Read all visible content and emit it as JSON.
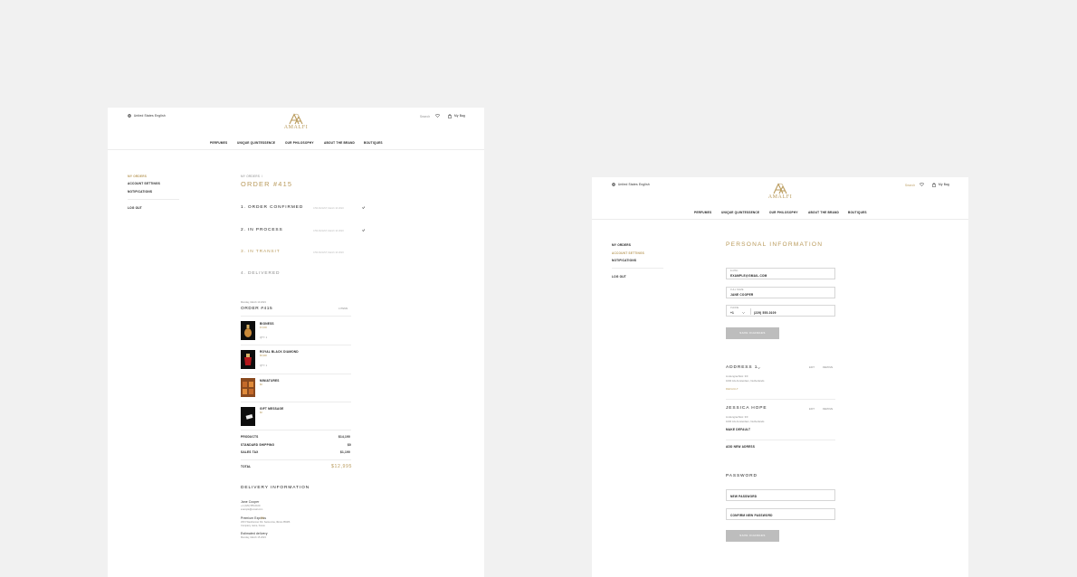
{
  "header": {
    "country": "United States",
    "language": "English",
    "search_label": "Search",
    "bag_label": "My Bag",
    "brand": "AMALFI",
    "nav": [
      "PERFUMES",
      "UNIQUE QUINTESSENCE",
      "OUR PHILOSOPHY",
      "ABOUT THE BRAND",
      "BOUTIQUES"
    ]
  },
  "sidebar": {
    "items": [
      "MY ORDERS",
      "ACCOUNT SETTINGS",
      "NOTIFICATIONS"
    ],
    "logout": "LOG OUT"
  },
  "order_page": {
    "breadcrumb": "MY ORDERS",
    "breadcrumb_sep": "/",
    "title": "ORDER #415",
    "steps": [
      {
        "label": "1.  ORDER CONFIRMED",
        "time": "4:56 AM EST, March 10 2023",
        "done": true
      },
      {
        "label": "2.  IN PROCESS",
        "time": "4:56 AM EST, March 10 2023",
        "done": true
      },
      {
        "label": "3.  IN TRANSIT",
        "time": "4:56 AM EST, March 10 2023",
        "done": false
      },
      {
        "label": "4.  DELIVERED",
        "time": "",
        "done": false
      }
    ],
    "order_date": "Monday, March 10 2023",
    "order_title": "ORDER #415",
    "items_count": "4 ITEMS",
    "items": [
      {
        "name": "BIONESS",
        "price": "$7,000",
        "qty": "QTY: 1"
      },
      {
        "name": "ROYAL BLACK DIAMOND",
        "price": "$5,990",
        "qty": "QTY: 1"
      },
      {
        "name": "MINIATURES",
        "price": "$0",
        "qty": ""
      },
      {
        "name": "GIFT MESSAGE",
        "price": "$0",
        "qty": ""
      }
    ],
    "summary": [
      {
        "label": "PRODUCTS",
        "value": "$14,190"
      },
      {
        "label": "STANDARD SHIPPING",
        "value": "$0"
      },
      {
        "label": "SALES TAX",
        "value": "$1,190"
      }
    ],
    "total_label": "TOTAL",
    "total_value": "$12,995",
    "delivery_title": "DELIVERY INFORMATION",
    "delivery": {
      "name": "Jane Cooper",
      "phone": "+1 (229) 555-0109",
      "email": "example@email.com",
      "method": "Premium Express",
      "method_price": "$0",
      "address": "2972 Westheimer Rd. Santa Ana, Illinois 85486",
      "address_extra": "Company name, house",
      "estimated_label": "Estimated delivery",
      "estimated_date": "Monday, March 15 2023"
    }
  },
  "settings_page": {
    "title": "PERSONAL INFORMATION",
    "email_label": "E-MAIL",
    "email_value": "EXAMPLE@GMAIL.COM",
    "name_label": "FULL NAME",
    "name_value": "JANE COOPER",
    "phone_label": "PHONE",
    "phone_code": "+1",
    "phone_value": "(229) 555-0109",
    "save_label": "SAVE CHANGES",
    "addresses": [
      {
        "title": "ADDRESS 1",
        "line1": "Lindengrachtstr. 3/F",
        "line2": "1000 AG Amsterdam, Netherlands",
        "tag": "DEFAULT",
        "edit": "EDIT",
        "remove": "REMOVE"
      },
      {
        "title": "JESSICA HOPE",
        "line1": "Lindengrachtstr. 3/F",
        "line2": "1000 AG Amsterdam, Netherlands",
        "tag": "MAKE DEFAULT",
        "edit": "EDIT",
        "remove": "REMOVE"
      }
    ],
    "add_address": "ADD NEW ADRESS",
    "password_title": "PASSWORD",
    "new_password_placeholder": "NEW PASSWORD",
    "confirm_password_placeholder": "CONFIRM NEW PASSWORD",
    "save_label_2": "SAVE CHANGES"
  },
  "colors": {
    "accent": "#b99a5b",
    "background": "#f1f1f1",
    "button": "#bdbdbd"
  },
  "icons": [
    "globe-icon",
    "heart-icon",
    "bag-icon",
    "check-icon",
    "chevron-down-icon",
    "logo-monogram"
  ]
}
